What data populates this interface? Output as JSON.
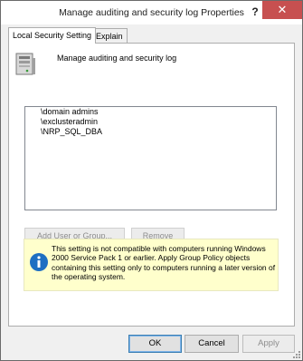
{
  "window": {
    "title": "Manage auditing and security log Properties",
    "help_label": "?",
    "close_label": "✕"
  },
  "tabs": [
    {
      "label": "Local Security Setting",
      "active": true
    },
    {
      "label": "Explain",
      "active": false
    }
  ],
  "policy": {
    "icon": "server-icon",
    "name": "Manage auditing and security log"
  },
  "members": [
    "\\domain admins",
    "\\exclusteradmin",
    "\\NRP_SQL_DBA"
  ],
  "member_buttons": {
    "add_label": "Add User or Group...",
    "remove_label": "Remove"
  },
  "notice": {
    "icon": "info-icon",
    "text": "This setting is not compatible with computers running Windows 2000 Service Pack 1 or earlier.  Apply Group Policy objects containing this setting only to computers running a later version of the operating system."
  },
  "dialog_buttons": {
    "ok_label": "OK",
    "cancel_label": "Cancel",
    "apply_label": "Apply"
  },
  "colors": {
    "close_button": "#c75050",
    "notice_background": "#ffffcc",
    "info_icon": "#1e6fc2"
  }
}
